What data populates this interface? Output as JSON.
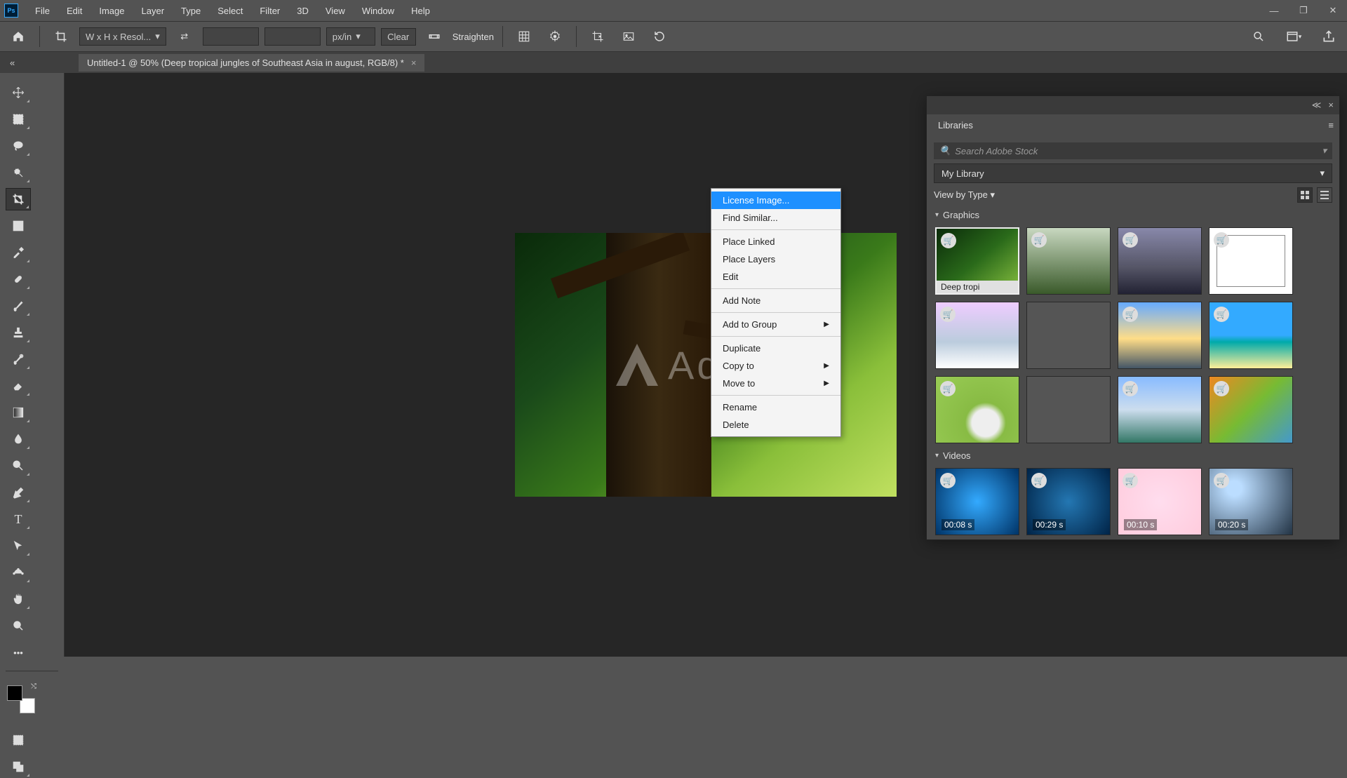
{
  "menu": [
    "File",
    "Edit",
    "Image",
    "Layer",
    "Type",
    "Select",
    "Filter",
    "3D",
    "View",
    "Window",
    "Help"
  ],
  "options": {
    "ratio_label": "W x H x Resol...",
    "unit": "px/in",
    "clear": "Clear",
    "straighten": "Straighten"
  },
  "doc_tab": "Untitled-1 @ 50% (Deep tropical jungles of Southeast Asia in august, RGB/8) *",
  "watermark": "Adobe",
  "libraries": {
    "panel_title": "Libraries",
    "search_placeholder": "Search Adobe Stock",
    "library_select": "My Library",
    "view_by": "View by Type",
    "graphics_label": "Graphics",
    "videos_label": "Videos",
    "selected_thumb_label": "Deep tropi",
    "vid_durations": [
      "00:08 s",
      "00:29 s",
      "00:10 s",
      "00:20 s"
    ]
  },
  "context_menu": {
    "license": "License Image...",
    "find": "Find Similar...",
    "place_linked": "Place Linked",
    "place_layers": "Place Layers",
    "edit": "Edit",
    "add_note": "Add Note",
    "add_group": "Add to Group",
    "duplicate": "Duplicate",
    "copy_to": "Copy to",
    "move_to": "Move to",
    "rename": "Rename",
    "delete": "Delete"
  }
}
